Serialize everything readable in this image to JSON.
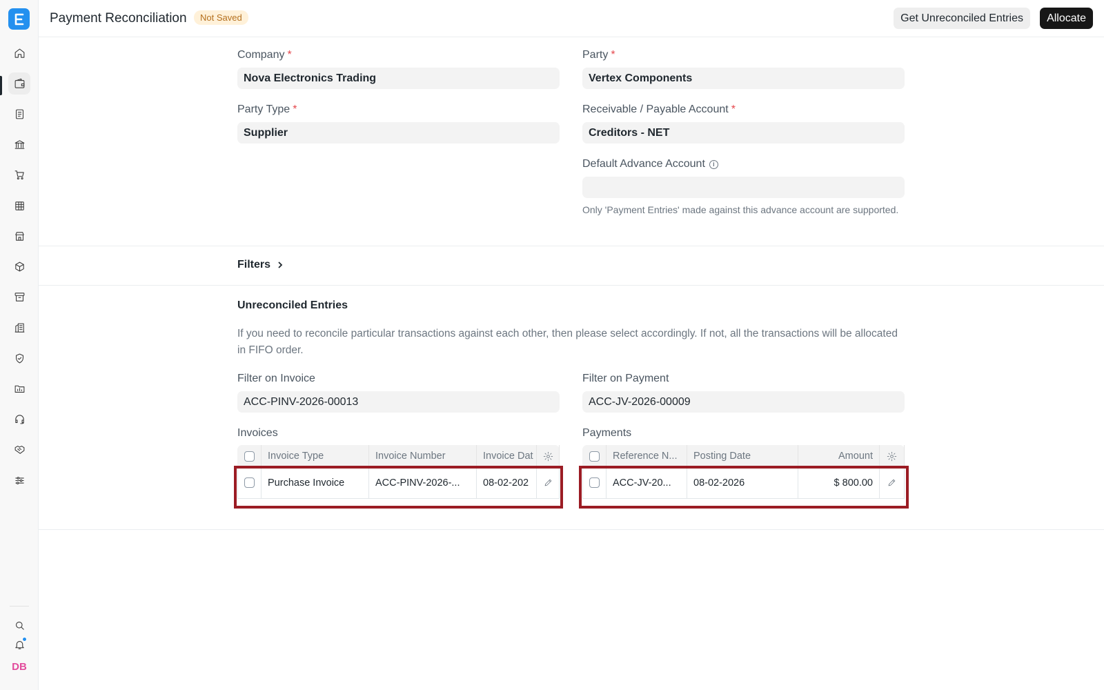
{
  "app": {
    "logo_letter": "E"
  },
  "header": {
    "title": "Payment Reconciliation",
    "status_badge": "Not Saved",
    "get_entries_button": "Get Unreconciled Entries",
    "allocate_button": "Allocate"
  },
  "sidebar": {
    "items": [
      {
        "name": "home-icon"
      },
      {
        "name": "wallet-icon"
      },
      {
        "name": "document-icon"
      },
      {
        "name": "bank-icon"
      },
      {
        "name": "cart-icon"
      },
      {
        "name": "table-icon"
      },
      {
        "name": "store-icon"
      },
      {
        "name": "package-icon"
      },
      {
        "name": "archive-icon"
      },
      {
        "name": "building-icon"
      },
      {
        "name": "shield-icon"
      },
      {
        "name": "folder-chart-icon"
      },
      {
        "name": "headset-icon"
      },
      {
        "name": "handshake-icon"
      },
      {
        "name": "sliders-icon"
      }
    ],
    "active_index": 1,
    "avatar_initials": "DB"
  },
  "form": {
    "company": {
      "label": "Company",
      "value": "Nova Electronics Trading"
    },
    "party": {
      "label": "Party",
      "value": "Vertex Components"
    },
    "party_type": {
      "label": "Party Type",
      "value": "Supplier"
    },
    "receivable_payable_account": {
      "label": "Receivable / Payable Account",
      "value": "Creditors - NET"
    },
    "default_advance_account": {
      "label": "Default Advance Account",
      "value": "",
      "help": "Only 'Payment Entries' made against this advance account are supported."
    }
  },
  "filters": {
    "label": "Filters"
  },
  "unreconciled": {
    "title": "Unreconciled Entries",
    "description": "If you need to reconcile particular transactions against each other, then please select accordingly. If not, all the transactions will be allocated in FIFO order.",
    "filter_on_invoice": {
      "label": "Filter on Invoice",
      "value": "ACC-PINV-2026-00013"
    },
    "filter_on_payment": {
      "label": "Filter on Payment",
      "value": "ACC-JV-2026-00009"
    },
    "invoices": {
      "label": "Invoices",
      "columns": [
        "Invoice Type",
        "Invoice Number",
        "Invoice Dat"
      ],
      "rows": [
        {
          "invoice_type": "Purchase Invoice",
          "invoice_number": "ACC-PINV-2026-...",
          "invoice_date": "08-02-202"
        }
      ]
    },
    "payments": {
      "label": "Payments",
      "columns": [
        "Reference N...",
        "Posting Date",
        "Amount"
      ],
      "rows": [
        {
          "reference_name": "ACC-JV-20...",
          "posting_date": "08-02-2026",
          "amount": "$ 800.00"
        }
      ]
    }
  },
  "colors": {
    "accent": "#2490ef",
    "highlight": "#9b1c24",
    "badge_bg": "#fff1d9",
    "badge_text": "#b5701e"
  }
}
